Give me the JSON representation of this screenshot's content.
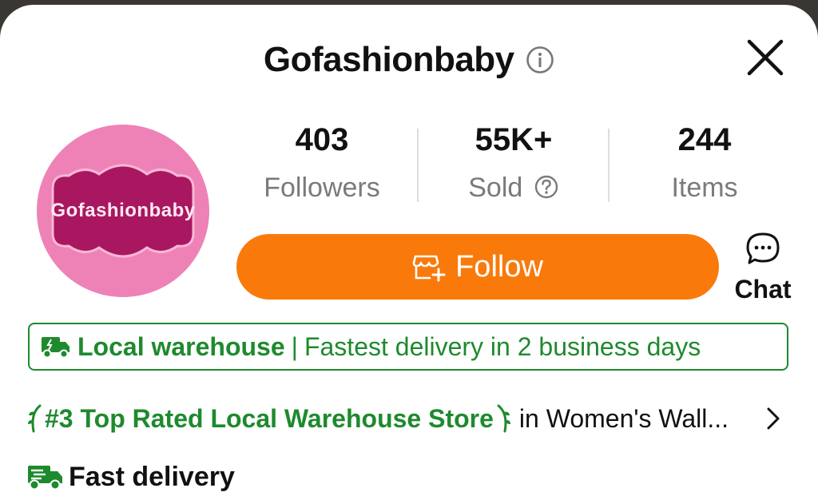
{
  "store": {
    "name": "Gofashionbaby",
    "logo_text": "Gofashionbaby"
  },
  "stats": [
    {
      "value": "403",
      "label": "Followers"
    },
    {
      "value": "55K+",
      "label": "Sold"
    },
    {
      "value": "244",
      "label": "Items"
    }
  ],
  "actions": {
    "follow_label": "Follow",
    "chat_label": "Chat"
  },
  "warehouse": {
    "title": "Local warehouse",
    "separator": "|",
    "detail": "Fastest delivery in 2 business days"
  },
  "ranking": {
    "badge": "#3 Top Rated Local Warehouse Store",
    "category": "in Women's Wall..."
  },
  "delivery": {
    "label": "Fast delivery"
  },
  "colors": {
    "accent_orange": "#f97a0b",
    "success_green": "#1e8a2e",
    "avatar_pink": "#ee82b6"
  },
  "icons": [
    "info-icon",
    "close-icon",
    "help-icon",
    "follow-store-icon",
    "chat-bubble-icon",
    "delivery-truck-icon",
    "laurel-icon",
    "chevron-right-icon"
  ]
}
